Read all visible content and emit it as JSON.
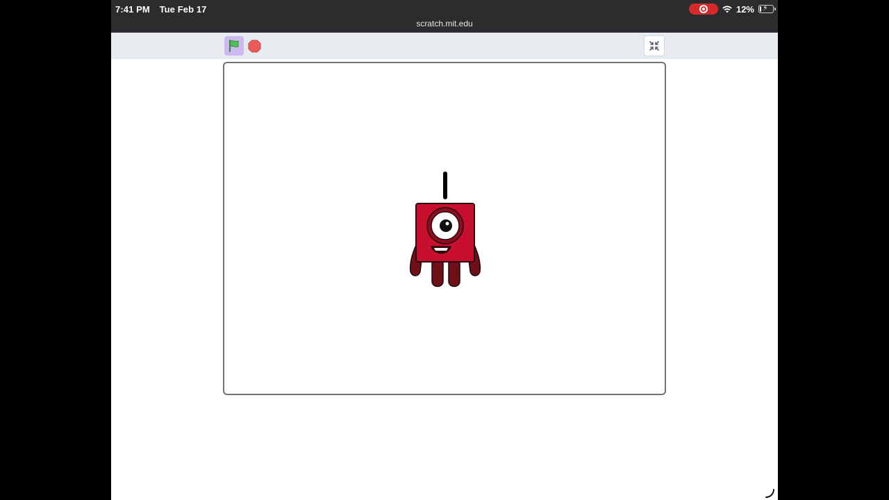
{
  "status_bar": {
    "time": "7:41 PM",
    "date": "Tue Feb 17",
    "url": "scratch.mit.edu",
    "battery": "12%",
    "battery_level": 0.12,
    "recording_icon": "screen-record-icon",
    "wifi_icon": "wifi-icon"
  },
  "toolbar": {
    "green_flag_icon": "green-flag-icon",
    "stop_icon": "stop-sign-icon",
    "fullscreen_exit_icon": "exit-fullscreen-icon"
  },
  "stage": {
    "sprite_icon": "numberblock-one-sprite"
  },
  "colors": {
    "status_bar": "#2c2c2e",
    "toolbar": "#e6ebf0",
    "flag_button": "#cdb8f0",
    "flag_green": "#4cbf56",
    "stop_red": "#ec5959",
    "sprite_red": "#c8102e",
    "recording_red": "#d62a2a"
  }
}
